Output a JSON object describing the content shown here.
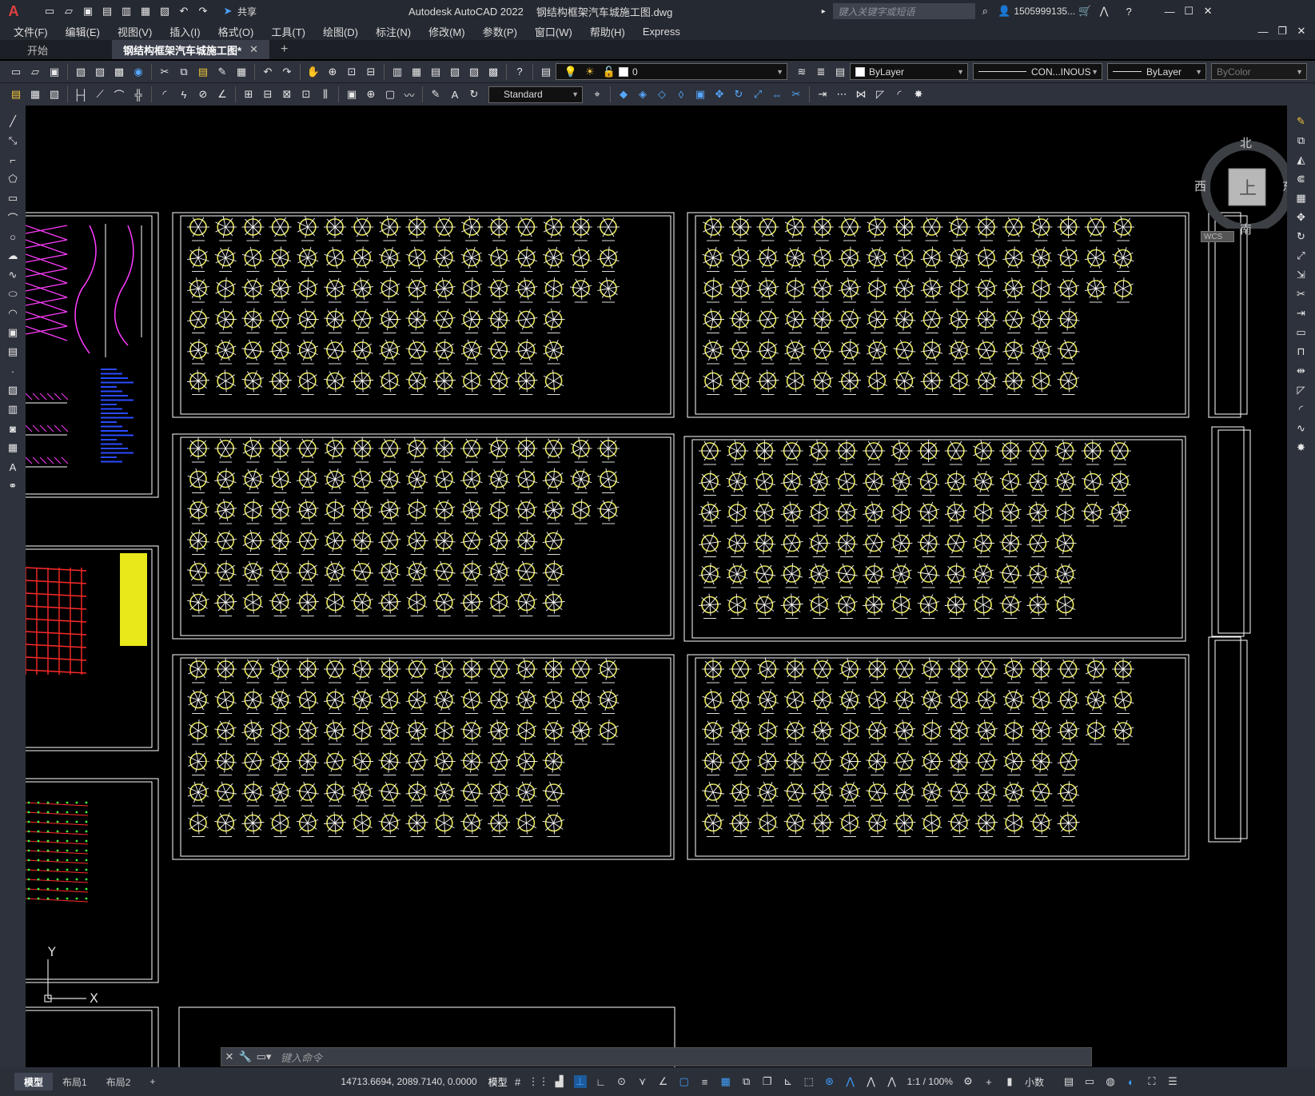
{
  "titlebar": {
    "app_title": "Autodesk AutoCAD 2022",
    "file_title": "钢结构框架汽车城施工图.dwg",
    "search_placeholder": "键入关键字或短语",
    "user": "1505999135...",
    "share": "共享"
  },
  "menu": [
    "文件(F)",
    "编辑(E)",
    "视图(V)",
    "插入(I)",
    "格式(O)",
    "工具(T)",
    "绘图(D)",
    "标注(N)",
    "修改(M)",
    "参数(P)",
    "窗口(W)",
    "帮助(H)",
    "Express"
  ],
  "tabs": {
    "start": "开始",
    "doc": "钢结构框架汽车城施工图*"
  },
  "props": {
    "layer": "0",
    "color": "ByLayer",
    "linetype": "CON...INOUS",
    "lineweight": "ByLayer",
    "plotstyle": "ByColor",
    "textstyle": "Standard"
  },
  "viewcube": {
    "north": "北",
    "south": "南",
    "east": "东",
    "west": "西",
    "top": "上",
    "wcs": "WCS"
  },
  "ucs": {
    "y": "Y",
    "x": "X"
  },
  "cmd": {
    "placeholder": "键入命令"
  },
  "status": {
    "tabs": [
      "模型",
      "布局1",
      "布局2"
    ],
    "coords": "14713.6694, 2089.7140, 0.0000",
    "model": "模型",
    "scale": "1:1 / 100%",
    "units": "小数"
  },
  "colors": {
    "accent": "#3fa0ff",
    "node_ring": "#e6e65a",
    "drawing_bg": "#000000"
  }
}
